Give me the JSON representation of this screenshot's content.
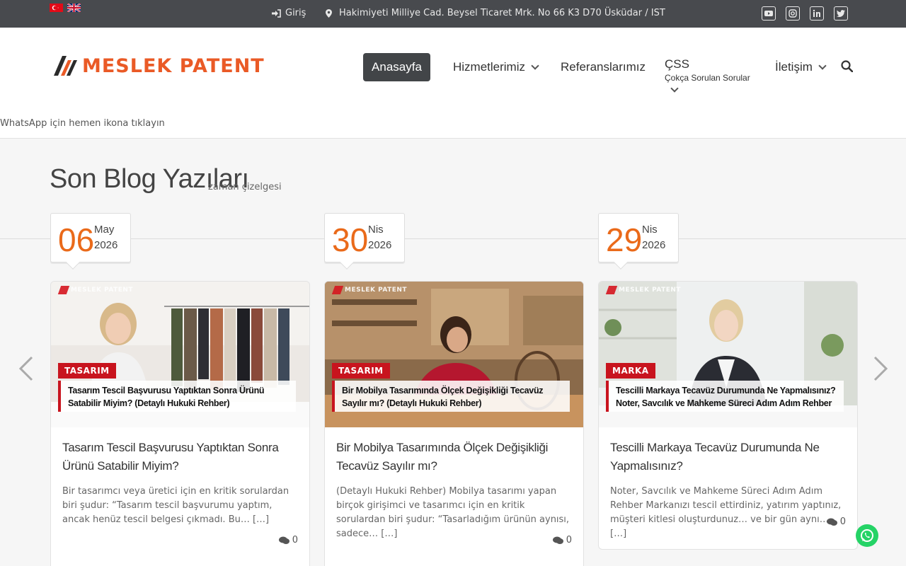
{
  "topbar": {
    "login_label": "Giriş",
    "address": "Hakimiyeti Milliye Cad. Beysel Ticaret Mrk. No 66 K3 D70 Üsküdar / IST",
    "socials": [
      "youtube-icon",
      "instagram-icon",
      "linkedin-icon",
      "twitter-icon"
    ]
  },
  "brand": {
    "name": "MESLEK PATENT",
    "color": "#ea5a26"
  },
  "nav": {
    "home": "Anasayfa",
    "services": "Hizmetlerimiz",
    "references": "Referanslarımız",
    "faq": "ÇSS",
    "faq_sub": "Çokça Sorulan Sorular",
    "contact": "İletişim"
  },
  "whatsapp_note": "WhatsApp için hemen ikona tıklayın",
  "section": {
    "title": "Son Blog Yazıları",
    "subtitle": "zaman çizelgesi"
  },
  "posts": [
    {
      "day": "06",
      "month": "May",
      "year": "2026",
      "image_logo": "MESLEK PATENT",
      "category": "TASARIM",
      "banner": "Tasarım Tescil Başvurusu Yaptıktan Sonra Ürünü Satabilir Miyim? (Detaylı Hukuki Rehber)",
      "title": "Tasarım Tescil Başvurusu Yaptıktan Sonra Ürünü Satabilir Miyim?",
      "excerpt": "Bir tasarımcı veya üretici için en kritik sorulardan biri şudur: “Tasarım tescil başvurumu yaptım, ancak henüz tescil belgesi çıkmadı. Bu… […]",
      "comments": "0"
    },
    {
      "day": "30",
      "month": "Nis",
      "year": "2026",
      "image_logo": "MESLEK PATENT",
      "category": "TASARIM",
      "banner": "Bir Mobilya Tasarımında Ölçek Değişikliği Tecavüz Sayılır mı? (Detaylı Hukuki Rehber)",
      "title": "Bir Mobilya Tasarımında Ölçek Değişikliği Tecavüz Sayılır mı?",
      "excerpt": " (Detaylı Hukuki Rehber) Mobilya tasarımı yapan birçok girişimci ve tasarımcı için en kritik sorulardan biri şudur: “Tasarladığım ürünün aynısı, sadece… […]",
      "comments": "0"
    },
    {
      "day": "29",
      "month": "Nis",
      "year": "2026",
      "image_logo": "MESLEK PATENT",
      "category": "MARKA",
      "banner": "Tescilli Markaya Tecavüz Durumunda Ne Yapmalısınız? Noter, Savcılık ve Mahkeme Süreci Adım Adım Rehber",
      "title": "Tescilli Markaya Tecavüz Durumunda Ne Yapmalısınız?",
      "excerpt": "Noter, Savcılık ve Mahkeme Süreci Adım Adım Rehber Markanızı tescil ettirdiniz, yatırım yaptınız, müşteri kitlesi oluşturdunuz… ve bir gün aynı… […]",
      "comments": "0"
    }
  ]
}
